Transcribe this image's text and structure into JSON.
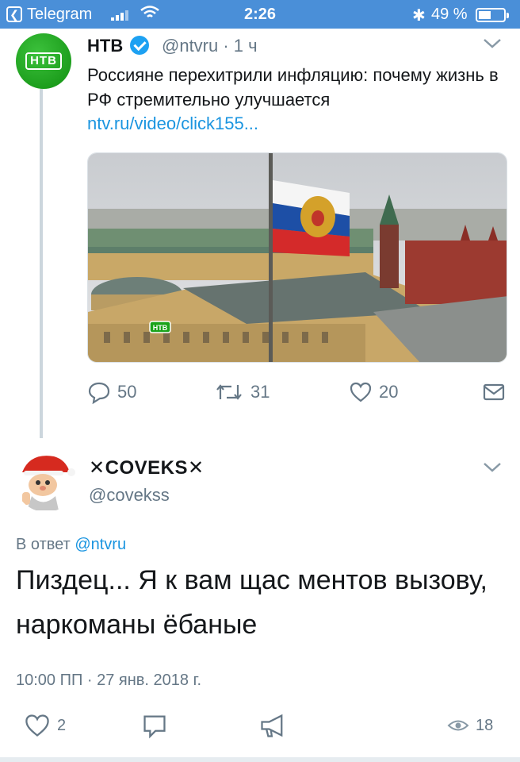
{
  "status_bar": {
    "back_app": "Telegram",
    "time": "2:26",
    "bluetooth": "✱",
    "battery_percent": "49 %",
    "battery_level": 0.49
  },
  "tweet1": {
    "name": "НТВ",
    "handle": "@ntvru · 1 ч",
    "avatar_logo": "НТВ",
    "text": "Россияне перехитрили инфляцию: почему жизнь в РФ стремительно улучшается",
    "link": "ntv.ru/video/click155...",
    "media_watermark": "НТВ",
    "replies": "50",
    "retweets": "31",
    "likes": "20",
    "icons": [
      "reply-icon",
      "retweet-icon",
      "like-icon",
      "mail-icon"
    ]
  },
  "tweet2": {
    "name": "✕COVEKS✕",
    "handle": "@covekss",
    "reply_prefix": "В ответ",
    "reply_mention": "@ntvru",
    "text": "Пиздец... Я к вам щас ментов вызову, наркоманы ёбаные",
    "meta": "10:00 ПП · 27 янв. 2018 г.",
    "replies": "2",
    "views": "18",
    "icons": [
      "reply-icon",
      "comment-icon",
      "megaphone-icon",
      "eye-icon"
    ]
  },
  "colors": {
    "status_bar": "#4a8fd8",
    "link": "#1b95e0",
    "muted": "#657786",
    "verified": "#1da1f2",
    "ntv_green": "#1aa31a"
  }
}
